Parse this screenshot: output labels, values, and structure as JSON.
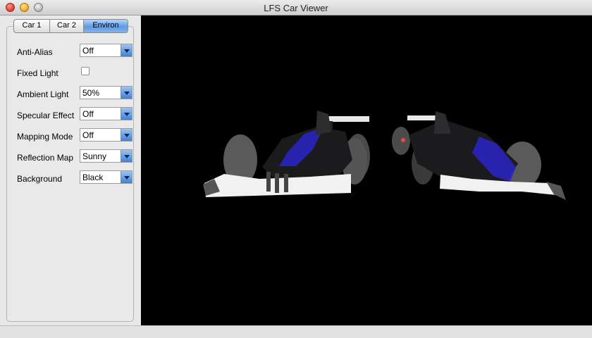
{
  "window": {
    "title": "LFS Car Viewer"
  },
  "tabs": [
    {
      "label": "Car 1"
    },
    {
      "label": "Car 2"
    },
    {
      "label": "Environ"
    }
  ],
  "settings": {
    "anti_alias": {
      "label": "Anti-Alias",
      "value": "Off"
    },
    "fixed_light": {
      "label": "Fixed Light",
      "checked": false
    },
    "ambient_light": {
      "label": "Ambient Light",
      "value": "50%"
    },
    "specular_effect": {
      "label": "Specular Effect",
      "value": "Off"
    },
    "mapping_mode": {
      "label": "Mapping Mode",
      "value": "Off"
    },
    "reflection_map": {
      "label": "Reflection Map",
      "value": "Sunny"
    },
    "background": {
      "label": "Background",
      "value": "Black"
    }
  },
  "viewport": {
    "background_color": "#000000",
    "accent_color": "#2a24c8"
  }
}
